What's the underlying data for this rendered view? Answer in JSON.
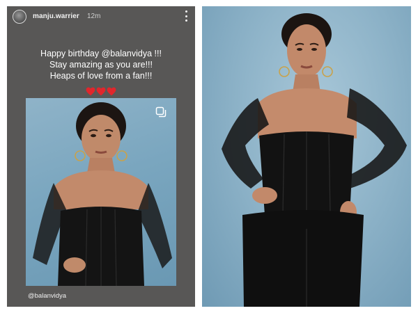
{
  "story": {
    "username": "manju.warrier",
    "timestamp": "12m",
    "more_icon": "more-vertical-icon",
    "caption_lines": [
      "Happy birthday @balanvidya !!!",
      "Stay amazing as you are!!!",
      "Heaps of love from a fan!!!"
    ],
    "hearts": [
      "red-heart-icon",
      "red-heart-icon",
      "red-heart-icon"
    ],
    "photo_icon": "multiple-photos-icon",
    "mention_tag": "@balanvidya"
  },
  "colors": {
    "story_background": "#585756",
    "photo_background": "#8fb4c9",
    "heart": "#e0262c",
    "outfit": "#141414"
  }
}
